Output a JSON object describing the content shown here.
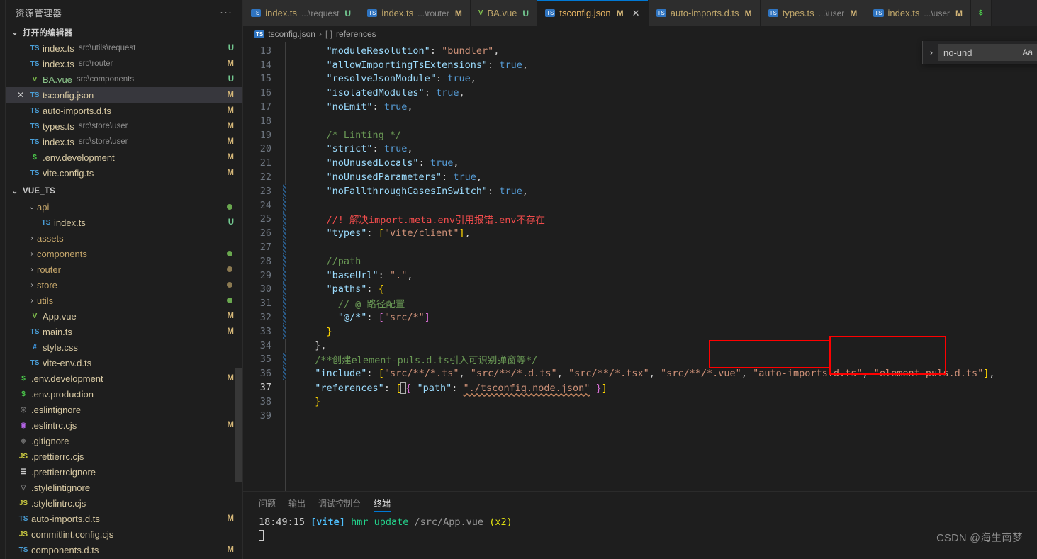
{
  "sidebar": {
    "title": "资源管理器",
    "more_icon": "···",
    "open_editors": {
      "label": "打开的编辑器",
      "chevron": "⌄",
      "items": [
        {
          "icon": "ts-icon",
          "icon_label": "TS",
          "name": "index.ts",
          "path": "src\\utils\\request",
          "badge": "U",
          "selected": false
        },
        {
          "icon": "ts-icon",
          "icon_label": "TS",
          "name": "index.ts",
          "path": "src\\router",
          "badge": "M",
          "selected": false
        },
        {
          "icon": "vue-icon",
          "icon_label": "V",
          "name": "BA.vue",
          "path": "src\\components",
          "badge": "U",
          "selected": false
        },
        {
          "icon": "json-icon",
          "icon_label": "TS",
          "name": "tsconfig.json",
          "path": "",
          "badge": "M",
          "selected": true,
          "close": "✕"
        },
        {
          "icon": "ts-icon",
          "icon_label": "TS",
          "name": "auto-imports.d.ts",
          "path": "",
          "badge": "M",
          "selected": false
        },
        {
          "icon": "ts-icon",
          "icon_label": "TS",
          "name": "types.ts",
          "path": "src\\store\\user",
          "badge": "M",
          "selected": false
        },
        {
          "icon": "ts-icon",
          "icon_label": "TS",
          "name": "index.ts",
          "path": "src\\store\\user",
          "badge": "M",
          "selected": false
        },
        {
          "icon": "env-icon",
          "icon_label": "$",
          "name": ".env.development",
          "path": "",
          "badge": "M",
          "selected": false
        },
        {
          "icon": "ts-icon",
          "icon_label": "TS",
          "name": "vite.config.ts",
          "path": "",
          "badge": "M",
          "selected": false
        }
      ]
    },
    "project": {
      "label": "VUE_TS",
      "chevron": "⌄",
      "items": [
        {
          "kind": "folder",
          "name": "api",
          "chevron": "⌄",
          "depth": 1,
          "dot": "green"
        },
        {
          "kind": "file",
          "icon_label": "TS",
          "icon": "ts-icon",
          "name": "index.ts",
          "depth": 2,
          "badge": "U"
        },
        {
          "kind": "folder",
          "name": "assets",
          "chevron": "›",
          "depth": 1,
          "dot": ""
        },
        {
          "kind": "folder",
          "name": "components",
          "chevron": "›",
          "depth": 1,
          "dot": "green"
        },
        {
          "kind": "folder",
          "name": "router",
          "chevron": "›",
          "depth": 1,
          "dot": "tan"
        },
        {
          "kind": "folder",
          "name": "store",
          "chevron": "›",
          "depth": 1,
          "dot": "tan"
        },
        {
          "kind": "folder",
          "name": "utils",
          "chevron": "›",
          "depth": 1,
          "dot": "green"
        },
        {
          "kind": "file",
          "icon_label": "V",
          "icon": "vue-icon",
          "name": "App.vue",
          "depth": 1,
          "badge": "M"
        },
        {
          "kind": "file",
          "icon_label": "TS",
          "icon": "ts-icon",
          "name": "main.ts",
          "depth": 1,
          "badge": "M"
        },
        {
          "kind": "file",
          "icon_label": "#",
          "icon": "css-icon",
          "name": "style.css",
          "depth": 1,
          "badge": ""
        },
        {
          "kind": "file",
          "icon_label": "TS",
          "icon": "ts-icon",
          "name": "vite-env.d.ts",
          "depth": 1,
          "badge": ""
        },
        {
          "kind": "file",
          "icon_label": "$",
          "icon": "env-icon",
          "name": ".env.development",
          "depth": 0,
          "badge": "M"
        },
        {
          "kind": "file",
          "icon_label": "$",
          "icon": "env-icon",
          "name": ".env.production",
          "depth": 0,
          "badge": ""
        },
        {
          "kind": "file",
          "icon_label": "◎",
          "icon": "eslintignore-icon",
          "name": ".eslintignore",
          "depth": 0,
          "badge": ""
        },
        {
          "kind": "file",
          "icon_label": "◉",
          "icon": "eslintrc-icon",
          "name": ".eslintrc.cjs",
          "depth": 0,
          "badge": "M"
        },
        {
          "kind": "file",
          "icon_label": "◈",
          "icon": "git-icon",
          "name": ".gitignore",
          "depth": 0,
          "badge": ""
        },
        {
          "kind": "file",
          "icon_label": "JS",
          "icon": "js-icon",
          "name": ".prettierrc.cjs",
          "depth": 0,
          "badge": ""
        },
        {
          "kind": "file",
          "icon_label": "☰",
          "icon": "prettierignore-icon",
          "name": ".prettierrcignore",
          "depth": 0,
          "badge": ""
        },
        {
          "kind": "file",
          "icon_label": "▽",
          "icon": "stylelintignore-icon",
          "name": ".stylelintignore",
          "depth": 0,
          "badge": ""
        },
        {
          "kind": "file",
          "icon_label": "JS",
          "icon": "js-icon",
          "name": ".stylelintrc.cjs",
          "depth": 0,
          "badge": ""
        },
        {
          "kind": "file",
          "icon_label": "TS",
          "icon": "ts-icon",
          "name": "auto-imports.d.ts",
          "depth": 0,
          "badge": "M"
        },
        {
          "kind": "file",
          "icon_label": "JS",
          "icon": "js-icon",
          "name": "commitlint.config.cjs",
          "depth": 0,
          "badge": ""
        },
        {
          "kind": "file",
          "icon_label": "TS",
          "icon": "ts-icon",
          "name": "components.d.ts",
          "depth": 0,
          "badge": "M"
        }
      ]
    }
  },
  "tabs": [
    {
      "icon_label": "TS",
      "name": "index.ts",
      "sub": "...\\request",
      "badge": "U",
      "active": false
    },
    {
      "icon_label": "TS",
      "name": "index.ts",
      "sub": "...\\router",
      "badge": "M",
      "active": false
    },
    {
      "icon_label": "V",
      "name": "BA.vue",
      "sub": "",
      "badge": "U",
      "active": false
    },
    {
      "icon_label": "TS",
      "name": "tsconfig.json",
      "sub": "",
      "badge": "M",
      "active": true,
      "close": "✕"
    },
    {
      "icon_label": "TS",
      "name": "auto-imports.d.ts",
      "sub": "",
      "badge": "M",
      "active": false
    },
    {
      "icon_label": "TS",
      "name": "types.ts",
      "sub": "...\\user",
      "badge": "M",
      "active": false
    },
    {
      "icon_label": "TS",
      "name": "index.ts",
      "sub": "...\\user",
      "badge": "M",
      "active": false
    },
    {
      "icon_label": "$",
      "name": "",
      "sub": "",
      "badge": "",
      "active": false
    }
  ],
  "breadcrumb": {
    "file_icon": "TS",
    "file": "tsconfig.json",
    "sep": "›",
    "node_icon": "[ ]",
    "node": "references"
  },
  "find_widget": {
    "chevron": "›",
    "value": "no-und",
    "options": "Aa"
  },
  "editor": {
    "lines": [
      {
        "n": "13",
        "dirty": false,
        "cur": false
      },
      {
        "n": "14",
        "dirty": false,
        "cur": false
      },
      {
        "n": "15",
        "dirty": false,
        "cur": false
      },
      {
        "n": "16",
        "dirty": false,
        "cur": false
      },
      {
        "n": "17",
        "dirty": false,
        "cur": false
      },
      {
        "n": "18",
        "dirty": false,
        "cur": false
      },
      {
        "n": "19",
        "dirty": false,
        "cur": false
      },
      {
        "n": "20",
        "dirty": false,
        "cur": false
      },
      {
        "n": "21",
        "dirty": false,
        "cur": false
      },
      {
        "n": "22",
        "dirty": false,
        "cur": false
      },
      {
        "n": "23",
        "dirty": true,
        "cur": false
      },
      {
        "n": "24",
        "dirty": true,
        "cur": false
      },
      {
        "n": "25",
        "dirty": true,
        "cur": false
      },
      {
        "n": "26",
        "dirty": true,
        "cur": false
      },
      {
        "n": "27",
        "dirty": true,
        "cur": false
      },
      {
        "n": "28",
        "dirty": true,
        "cur": false
      },
      {
        "n": "29",
        "dirty": true,
        "cur": false
      },
      {
        "n": "30",
        "dirty": true,
        "cur": false
      },
      {
        "n": "31",
        "dirty": true,
        "cur": false
      },
      {
        "n": "32",
        "dirty": true,
        "cur": false
      },
      {
        "n": "33",
        "dirty": true,
        "cur": false
      },
      {
        "n": "34",
        "dirty": false,
        "cur": false
      },
      {
        "n": "35",
        "dirty": true,
        "cur": false
      },
      {
        "n": "36",
        "dirty": true,
        "cur": false
      },
      {
        "n": "37",
        "dirty": false,
        "cur": true
      },
      {
        "n": "38",
        "dirty": false,
        "cur": false
      },
      {
        "n": "39",
        "dirty": false,
        "cur": false
      }
    ],
    "source": {
      "l13_key": "\"moduleResolution\"",
      "l13_val": "\"bundler\"",
      "l14_key": "\"allowImportingTsExtensions\"",
      "l14_val": "true",
      "l15_key": "\"resolveJsonModule\"",
      "l15_val": "true",
      "l16_key": "\"isolatedModules\"",
      "l16_val": "true",
      "l17_key": "\"noEmit\"",
      "l17_val": "true",
      "l19_comment": "/* Linting */",
      "l20_key": "\"strict\"",
      "l20_val": "true",
      "l21_key": "\"noUnusedLocals\"",
      "l21_val": "true",
      "l22_key": "\"noUnusedParameters\"",
      "l22_val": "true",
      "l23_key": "\"noFallthroughCasesInSwitch\"",
      "l23_val": "true",
      "l25_comment": "//! 解决import.meta.env引用报错.env不存在",
      "l26_key": "\"types\"",
      "l26_val": "\"vite/client\"",
      "l28_comment": "//path",
      "l29_key": "\"baseUrl\"",
      "l29_val": "\".\"",
      "l30_key": "\"paths\"",
      "l31_comment": "// @ 路径配置",
      "l32_key": "\"@/*\"",
      "l32_val": "\"src/*\"",
      "l35_comment": "/**创建element-puls.d.ts引入可识别弹窗等*/",
      "l36_key": "\"include\"",
      "l36_v1": "\"src/**/*.ts\"",
      "l36_v2": "\"src/**/*.d.ts\"",
      "l36_v3": "\"src/**/*.tsx\"",
      "l36_v4": "\"src/**/*.vue\"",
      "l36_v5": "\"auto-imports.d.ts\"",
      "l36_v6": "\"element-puls.d.ts\"",
      "l37_key": "\"references\"",
      "l37_pathkey": "\"path\"",
      "l37_pathval": "\"./tsconfig.node.json\""
    }
  },
  "panel": {
    "tabs": [
      {
        "label": "问题",
        "active": false
      },
      {
        "label": "输出",
        "active": false
      },
      {
        "label": "调试控制台",
        "active": false
      },
      {
        "label": "终端",
        "active": true
      }
    ],
    "terminal": {
      "time": "18:49:15",
      "tag": "[vite]",
      "action": "hmr update",
      "path": "/src/App.vue",
      "count": "(x2)"
    }
  },
  "watermark": "CSDN @海生南梦"
}
